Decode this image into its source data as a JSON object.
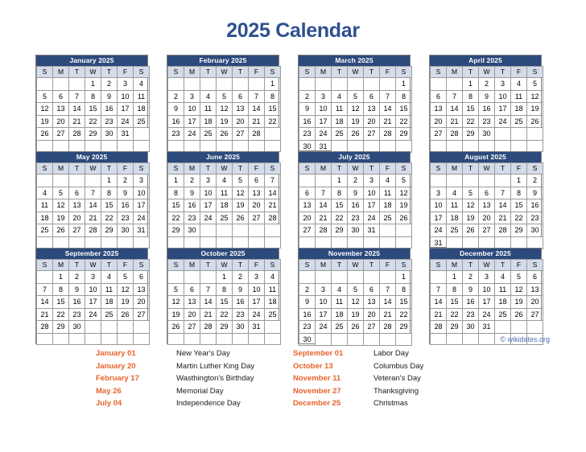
{
  "title": "2025 Calendar",
  "credit": "© wikidates.org",
  "colors": {
    "title": "#2e5090",
    "month_header_bg": "#2c4a7c",
    "weekday_bg": "#d4dcea",
    "holiday_red": "#ff0000",
    "legend_date": "#e8622a",
    "credit": "#4a6fb5"
  },
  "weekdays": [
    "S",
    "M",
    "T",
    "W",
    "T",
    "F",
    "S"
  ],
  "months": [
    {
      "name": "January 2025",
      "weeks": [
        [
          "",
          "",
          "",
          "1",
          "2",
          "3",
          "4"
        ],
        [
          "5",
          "6",
          "7",
          "8",
          "9",
          "10",
          "11"
        ],
        [
          "12",
          "13",
          "14",
          "15",
          "16",
          "17",
          "18"
        ],
        [
          "19",
          "20",
          "21",
          "22",
          "23",
          "24",
          "25"
        ],
        [
          "26",
          "27",
          "28",
          "29",
          "30",
          "31",
          ""
        ],
        [
          "",
          "",
          "",
          "",
          "",
          "",
          ""
        ]
      ],
      "holidays": [
        "1",
        "20"
      ]
    },
    {
      "name": "February 2025",
      "weeks": [
        [
          "",
          "",
          "",
          "",
          "",
          "",
          "1"
        ],
        [
          "2",
          "3",
          "4",
          "5",
          "6",
          "7",
          "8"
        ],
        [
          "9",
          "10",
          "11",
          "12",
          "13",
          "14",
          "15"
        ],
        [
          "16",
          "17",
          "18",
          "19",
          "20",
          "21",
          "22"
        ],
        [
          "23",
          "24",
          "25",
          "26",
          "27",
          "28",
          ""
        ],
        [
          "",
          "",
          "",
          "",
          "",
          "",
          ""
        ]
      ],
      "holidays": [
        "17"
      ]
    },
    {
      "name": "March 2025",
      "weeks": [
        [
          "",
          "",
          "",
          "",
          "",
          "",
          "1"
        ],
        [
          "2",
          "3",
          "4",
          "5",
          "6",
          "7",
          "8"
        ],
        [
          "9",
          "10",
          "11",
          "12",
          "13",
          "14",
          "15"
        ],
        [
          "16",
          "17",
          "18",
          "19",
          "20",
          "21",
          "22"
        ],
        [
          "23",
          "24",
          "25",
          "26",
          "27",
          "28",
          "29"
        ],
        [
          "30",
          "31",
          "",
          "",
          "",
          "",
          ""
        ]
      ],
      "holidays": []
    },
    {
      "name": "April 2025",
      "weeks": [
        [
          "",
          "",
          "1",
          "2",
          "3",
          "4",
          "5"
        ],
        [
          "6",
          "7",
          "8",
          "9",
          "10",
          "11",
          "12"
        ],
        [
          "13",
          "14",
          "15",
          "16",
          "17",
          "18",
          "19"
        ],
        [
          "20",
          "21",
          "22",
          "23",
          "24",
          "25",
          "26"
        ],
        [
          "27",
          "28",
          "29",
          "30",
          "",
          "",
          ""
        ],
        [
          "",
          "",
          "",
          "",
          "",
          "",
          ""
        ]
      ],
      "holidays": []
    },
    {
      "name": "May 2025",
      "weeks": [
        [
          "",
          "",
          "",
          "",
          "1",
          "2",
          "3"
        ],
        [
          "4",
          "5",
          "6",
          "7",
          "8",
          "9",
          "10"
        ],
        [
          "11",
          "12",
          "13",
          "14",
          "15",
          "16",
          "17"
        ],
        [
          "18",
          "19",
          "20",
          "21",
          "22",
          "23",
          "24"
        ],
        [
          "25",
          "26",
          "27",
          "28",
          "29",
          "30",
          "31"
        ],
        [
          "",
          "",
          "",
          "",
          "",
          "",
          ""
        ]
      ],
      "holidays": [
        "26"
      ]
    },
    {
      "name": "June 2025",
      "weeks": [
        [
          "1",
          "2",
          "3",
          "4",
          "5",
          "6",
          "7"
        ],
        [
          "8",
          "9",
          "10",
          "11",
          "12",
          "13",
          "14"
        ],
        [
          "15",
          "16",
          "17",
          "18",
          "19",
          "20",
          "21"
        ],
        [
          "22",
          "23",
          "24",
          "25",
          "26",
          "27",
          "28"
        ],
        [
          "29",
          "30",
          "",
          "",
          "",
          "",
          ""
        ],
        [
          "",
          "",
          "",
          "",
          "",
          "",
          ""
        ]
      ],
      "holidays": []
    },
    {
      "name": "July 2025",
      "weeks": [
        [
          "",
          "",
          "1",
          "2",
          "3",
          "4",
          "5"
        ],
        [
          "6",
          "7",
          "8",
          "9",
          "10",
          "11",
          "12"
        ],
        [
          "13",
          "14",
          "15",
          "16",
          "17",
          "18",
          "19"
        ],
        [
          "20",
          "21",
          "22",
          "23",
          "24",
          "25",
          "26"
        ],
        [
          "27",
          "28",
          "29",
          "30",
          "31",
          "",
          ""
        ],
        [
          "",
          "",
          "",
          "",
          "",
          "",
          ""
        ]
      ],
      "holidays": [
        "4"
      ]
    },
    {
      "name": "August 2025",
      "weeks": [
        [
          "",
          "",
          "",
          "",
          "",
          "1",
          "2"
        ],
        [
          "3",
          "4",
          "5",
          "6",
          "7",
          "8",
          "9"
        ],
        [
          "10",
          "11",
          "12",
          "13",
          "14",
          "15",
          "16"
        ],
        [
          "17",
          "18",
          "19",
          "20",
          "21",
          "22",
          "23"
        ],
        [
          "24",
          "25",
          "26",
          "27",
          "28",
          "29",
          "30"
        ],
        [
          "31",
          "",
          "",
          "",
          "",
          "",
          ""
        ]
      ],
      "holidays": []
    },
    {
      "name": "September 2025",
      "weeks": [
        [
          "",
          "1",
          "2",
          "3",
          "4",
          "5",
          "6"
        ],
        [
          "7",
          "8",
          "9",
          "10",
          "11",
          "12",
          "13"
        ],
        [
          "14",
          "15",
          "16",
          "17",
          "18",
          "19",
          "20"
        ],
        [
          "21",
          "22",
          "23",
          "24",
          "25",
          "26",
          "27"
        ],
        [
          "28",
          "29",
          "30",
          "",
          "",
          "",
          ""
        ],
        [
          "",
          "",
          "",
          "",
          "",
          "",
          ""
        ]
      ],
      "holidays": [
        "1"
      ]
    },
    {
      "name": "October 2025",
      "weeks": [
        [
          "",
          "",
          "",
          "1",
          "2",
          "3",
          "4"
        ],
        [
          "5",
          "6",
          "7",
          "8",
          "9",
          "10",
          "11"
        ],
        [
          "12",
          "13",
          "14",
          "15",
          "16",
          "17",
          "18"
        ],
        [
          "19",
          "20",
          "21",
          "22",
          "23",
          "24",
          "25"
        ],
        [
          "26",
          "27",
          "28",
          "29",
          "30",
          "31",
          ""
        ],
        [
          "",
          "",
          "",
          "",
          "",
          "",
          ""
        ]
      ],
      "holidays": [
        "13"
      ]
    },
    {
      "name": "November 2025",
      "weeks": [
        [
          "",
          "",
          "",
          "",
          "",
          "",
          "1"
        ],
        [
          "2",
          "3",
          "4",
          "5",
          "6",
          "7",
          "8"
        ],
        [
          "9",
          "10",
          "11",
          "12",
          "13",
          "14",
          "15"
        ],
        [
          "16",
          "17",
          "18",
          "19",
          "20",
          "21",
          "22"
        ],
        [
          "23",
          "24",
          "25",
          "26",
          "27",
          "28",
          "29"
        ],
        [
          "30",
          "",
          "",
          "",
          "",
          "",
          ""
        ]
      ],
      "holidays": [
        "11",
        "27"
      ]
    },
    {
      "name": "December 2025",
      "weeks": [
        [
          "",
          "1",
          "2",
          "3",
          "4",
          "5",
          "6"
        ],
        [
          "7",
          "8",
          "9",
          "10",
          "11",
          "12",
          "13"
        ],
        [
          "14",
          "15",
          "16",
          "17",
          "18",
          "19",
          "20"
        ],
        [
          "21",
          "22",
          "23",
          "24",
          "25",
          "26",
          "27"
        ],
        [
          "28",
          "29",
          "30",
          "31",
          "",
          "",
          ""
        ],
        [
          "",
          "",
          "",
          "",
          "",
          "",
          ""
        ]
      ],
      "holidays": [
        "25"
      ]
    }
  ],
  "holiday_legend": {
    "left_column": [
      {
        "date": "January 01",
        "name": "New Year's Day"
      },
      {
        "date": "January 20",
        "name": "Martin Luther King Day"
      },
      {
        "date": "February 17",
        "name": "Wasthington's Birthday"
      },
      {
        "date": "May 26",
        "name": "Memorial Day"
      },
      {
        "date": "July 04",
        "name": "Independence Day"
      }
    ],
    "right_column": [
      {
        "date": "September 01",
        "name": "Labor Day"
      },
      {
        "date": "October 13",
        "name": "Columbus Day"
      },
      {
        "date": "November 11",
        "name": "Veteran's Day"
      },
      {
        "date": "November 27",
        "name": "Thanksgiving"
      },
      {
        "date": "December 25",
        "name": "Christmas"
      }
    ]
  }
}
